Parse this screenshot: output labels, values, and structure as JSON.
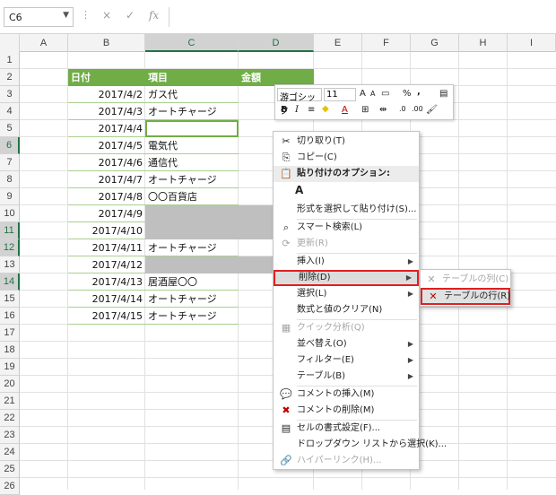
{
  "name_box": "C6",
  "formula_bar": {
    "fx_label": "fx",
    "cancel_icon": "×",
    "enter_icon": "✓"
  },
  "columns": [
    "A",
    "B",
    "C",
    "D",
    "E",
    "F",
    "G",
    "H",
    "I"
  ],
  "rows": [
    "1",
    "2",
    "3",
    "4",
    "5",
    "6",
    "7",
    "8",
    "9",
    "10",
    "11",
    "12",
    "13",
    "14",
    "15",
    "16",
    "17",
    "18",
    "19",
    "20",
    "21",
    "22",
    "23",
    "24",
    "25",
    "26"
  ],
  "table": {
    "headers": [
      "日付",
      "項目",
      "金額"
    ],
    "rows": [
      {
        "date": "2017/4/2",
        "item": "ガス代"
      },
      {
        "date": "2017/4/3",
        "item": "オートチャージ"
      },
      {
        "date": "2017/4/4",
        "item": ""
      },
      {
        "date": "2017/4/5",
        "item": "電気代"
      },
      {
        "date": "2017/4/6",
        "item": "通信代"
      },
      {
        "date": "2017/4/7",
        "item": "オートチャージ"
      },
      {
        "date": "2017/4/8",
        "item": "〇〇百貨店"
      },
      {
        "date": "2017/4/9",
        "item": ""
      },
      {
        "date": "2017/4/10",
        "item": ""
      },
      {
        "date": "2017/4/11",
        "item": "オートチャージ"
      },
      {
        "date": "2017/4/12",
        "item": ""
      },
      {
        "date": "2017/4/13",
        "item": "居酒屋〇〇"
      },
      {
        "date": "2017/4/14",
        "item": "オートチャージ"
      },
      {
        "date": "2017/4/15",
        "item": "オートチャージ"
      }
    ]
  },
  "mini_toolbar": {
    "font": "游ゴシック",
    "size": "11",
    "bold": "B",
    "italic": "I",
    "percent": "%",
    "comma": ","
  },
  "context_menu": {
    "items": [
      {
        "label": "切り取り(T)",
        "icon": "scissors-icon",
        "glyph": "✂"
      },
      {
        "label": "コピー(C)",
        "icon": "copy-icon",
        "glyph": "⎘"
      },
      {
        "label": "貼り付けのオプション:",
        "icon": "paste-icon",
        "glyph": "📋"
      },
      {
        "label": "形式を選択して貼り付け(S)...",
        "icon": "",
        "glyph": ""
      },
      {
        "label": "スマート検索(L)",
        "icon": "search-icon",
        "glyph": "⌕"
      },
      {
        "label": "更新(R)",
        "icon": "refresh-icon",
        "glyph": "⟳"
      },
      {
        "label": "挿入(I)",
        "icon": "",
        "glyph": ""
      },
      {
        "label": "削除(D)",
        "icon": "",
        "glyph": ""
      },
      {
        "label": "選択(L)",
        "icon": "",
        "glyph": ""
      },
      {
        "label": "数式と値のクリア(N)",
        "icon": "",
        "glyph": ""
      },
      {
        "label": "クイック分析(Q)",
        "icon": "quick-analysis-icon",
        "glyph": "▦"
      },
      {
        "label": "並べ替え(O)",
        "icon": "",
        "glyph": ""
      },
      {
        "label": "フィルター(E)",
        "icon": "",
        "glyph": ""
      },
      {
        "label": "テーブル(B)",
        "icon": "",
        "glyph": ""
      },
      {
        "label": "コメントの挿入(M)",
        "icon": "comment-add-icon",
        "glyph": "💬"
      },
      {
        "label": "コメントの削除(M)",
        "icon": "comment-delete-icon",
        "glyph": "✖"
      },
      {
        "label": "セルの書式設定(F)...",
        "icon": "format-cells-icon",
        "glyph": "▤"
      },
      {
        "label": "ドロップダウン リストから選択(K)...",
        "icon": "",
        "glyph": ""
      },
      {
        "label": "ハイパーリンク(H)...",
        "icon": "hyperlink-icon",
        "glyph": "🔗"
      }
    ],
    "paste_option_glyph": "A"
  },
  "submenu": {
    "items": [
      {
        "label": "テーブルの列(C)"
      },
      {
        "label": "テーブルの行(R)"
      }
    ]
  },
  "colors": {
    "header_green": "#70ad47",
    "highlight_red": "#e02020",
    "selected_gray": "#bfbfbf"
  }
}
